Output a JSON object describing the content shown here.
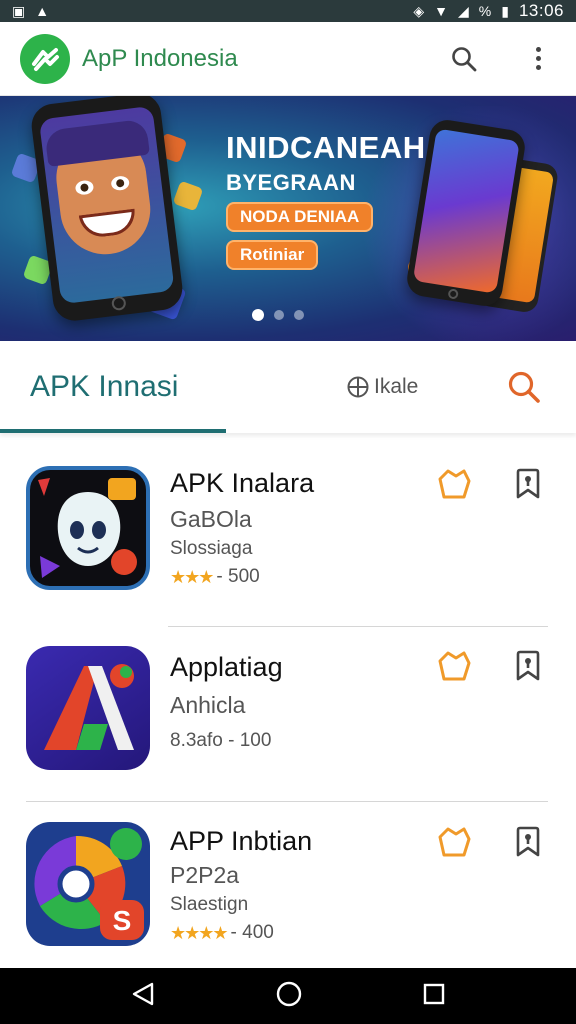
{
  "status_bar": {
    "time": "13:06",
    "battery_text": "%"
  },
  "app_bar": {
    "title": "ApP Indonesia"
  },
  "banner": {
    "title": "INIDCANEAH",
    "subtitle": "BYEGRAAN",
    "pill_primary": "NODA DENIAA",
    "pill_secondary": "Rotiniar",
    "page_count": 3,
    "active_page": 1
  },
  "tabs": {
    "active_label": "APK Innasi",
    "second_label": "Ikale"
  },
  "apps": [
    {
      "name": "APK Inalara",
      "developer": "GaBOla",
      "category": "Slossiaga",
      "rating_text": "★★★",
      "meta": "- 500"
    },
    {
      "name": "Applatiag",
      "developer": "Anhicla",
      "category": "",
      "rating_text": "",
      "meta": "8.3afo - 100"
    },
    {
      "name": "APP Inbtian",
      "developer": "P2P2a",
      "category": "Slaestign",
      "rating_text": "★★★★",
      "meta": "- 400"
    }
  ],
  "colors": {
    "accent_teal": "#1f6e72",
    "brand_green": "#2db34a",
    "favorite_orange": "#f09a2a",
    "star_gold": "#f2a51f"
  }
}
